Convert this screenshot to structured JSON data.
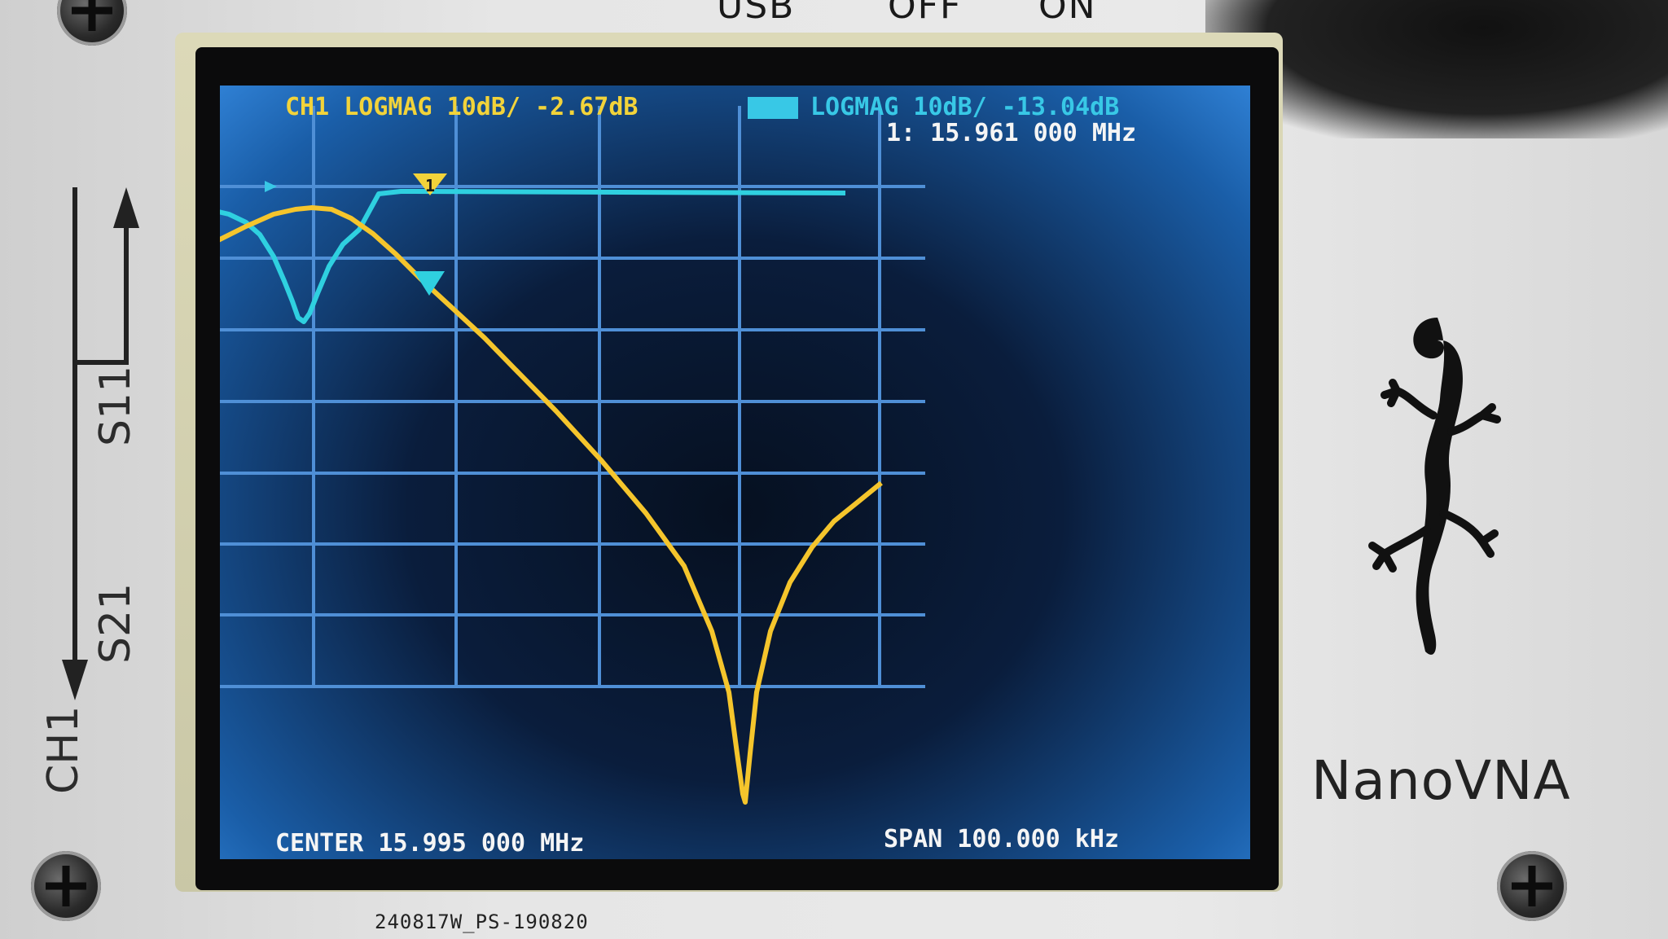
{
  "device": {
    "top_labels": [
      "USB",
      "OFF",
      "ON"
    ],
    "left_labels": {
      "ch1": "CH1",
      "s21": "S21",
      "s11": "S11"
    },
    "brand": "NanoVNA",
    "serial": "240817W_PS-190820"
  },
  "screen": {
    "trace1_label": "CH1 LOGMAG 10dB/ -2.67dB",
    "trace2_label": "LOGMAG 10dB/ -13.04dB",
    "marker_readout": "1: 15.961 000 MHz",
    "center": "CENTER 15.995 000 MHz",
    "span": "SPAN 100.000 kHz",
    "marker_id": "1",
    "colors": {
      "trace1": "#f5c52c",
      "trace2": "#2fd0e0",
      "grid": "#4f8fd6",
      "text_yellow": "#f2d33a",
      "text_cyan": "#38c8e6",
      "text_white": "#f5f5f5"
    }
  }
}
